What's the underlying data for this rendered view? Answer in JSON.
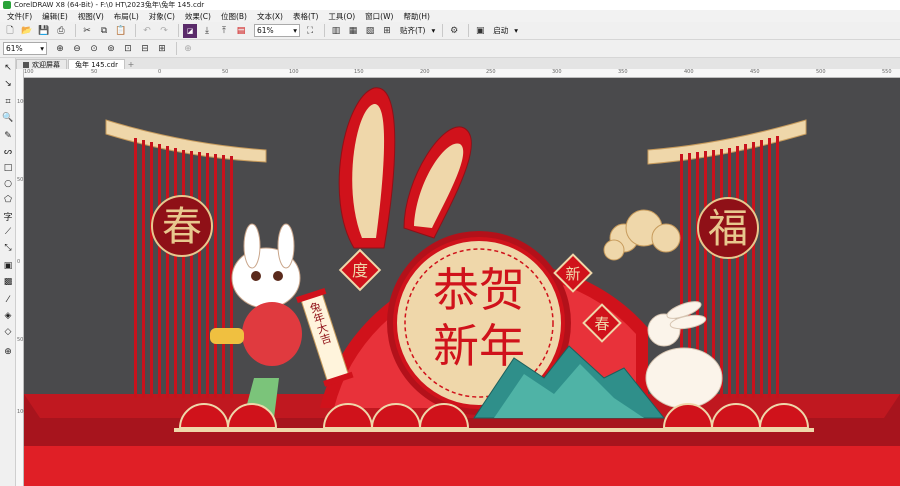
{
  "window": {
    "title": "CorelDRAW X8 (64-Bit) - F:\\0 HT\\2023兔年\\兔年 145.cdr"
  },
  "menu": [
    "文件(F)",
    "编辑(E)",
    "视图(V)",
    "布局(L)",
    "对象(C)",
    "效果(C)",
    "位图(B)",
    "文本(X)",
    "表格(T)",
    "工具(O)",
    "窗口(W)",
    "帮助(H)"
  ],
  "toolbar": {
    "zoom_value": "61%",
    "snap_label": "贴齐(T)",
    "launch_label": "启动"
  },
  "propertybar": {
    "zoom_value": "61%"
  },
  "tabs": [
    {
      "label": "欢迎屏幕",
      "active": false
    },
    {
      "label": "兔年 145.cdr",
      "active": true
    }
  ],
  "ruler": {
    "ticks": [
      "100",
      "50",
      "0",
      "50",
      "100",
      "150",
      "200",
      "250",
      "300",
      "350",
      "400",
      "450",
      "500",
      "550"
    ],
    "vticks": [
      "100",
      "50",
      "0",
      "50",
      "100"
    ]
  },
  "artwork": {
    "headline_line1": "恭贺",
    "headline_line2": "新年",
    "left_medallion": "春",
    "right_medallion": "福",
    "tag_left": "度",
    "tag_right_top": "新",
    "tag_right_bottom": "春",
    "scroll_text": "兔年大吉",
    "colors": {
      "red": "#d0121b",
      "dark_red": "#8f1017",
      "cream": "#f0d7a8",
      "teal": "#2f8f8a",
      "stage": "#a7141d"
    }
  }
}
